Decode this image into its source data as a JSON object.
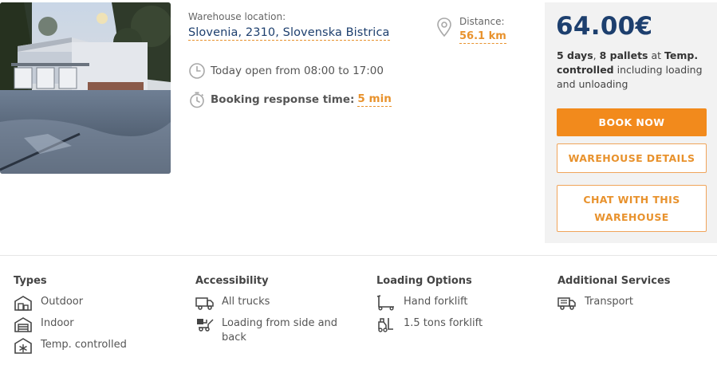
{
  "listing": {
    "photo_alt": "Warehouse photo",
    "location_label": "Warehouse location:",
    "location_value": "Slovenia, 2310, Slovenska Bistrica",
    "hours": "Today open from 08:00 to 17:00",
    "booking_label": "Booking response time:",
    "booking_value": "5 min",
    "distance_label": "Distance:",
    "distance_value": "56.1 km"
  },
  "offer": {
    "price": "64.00€",
    "desc_days": "5 days",
    "desc_sep1": ", ",
    "desc_pallets": "8 pallets",
    "desc_at": " at ",
    "desc_type": "Temp. controlled",
    "desc_rest": " including loading and unloading",
    "book_label": "BOOK NOW",
    "details_label": "WAREHOUSE DETAILS",
    "chat_label": "CHAT WITH THIS WAREHOUSE"
  },
  "features": {
    "types": {
      "title": "Types",
      "items": [
        {
          "label": "Outdoor",
          "icon": "outdoor-warehouse-icon"
        },
        {
          "label": "Indoor",
          "icon": "indoor-warehouse-icon"
        },
        {
          "label": "Temp. controlled",
          "icon": "snowflake-icon"
        }
      ]
    },
    "accessibility": {
      "title": "Accessibility",
      "items": [
        {
          "label": "All trucks",
          "icon": "truck-icon"
        },
        {
          "label": "Loading from side and back",
          "icon": "side-loading-icon"
        }
      ]
    },
    "loading": {
      "title": "Loading Options",
      "items": [
        {
          "label": "Hand forklift",
          "icon": "hand-forklift-icon"
        },
        {
          "label": "1.5 tons forklift",
          "icon": "forklift-icon"
        }
      ]
    },
    "services": {
      "title": "Additional Services",
      "items": [
        {
          "label": "Transport",
          "icon": "transport-truck-icon"
        }
      ]
    }
  },
  "colors": {
    "accent": "#f28a1c",
    "navy": "#1d3f6e",
    "panel_bg": "#f2f2f2"
  }
}
